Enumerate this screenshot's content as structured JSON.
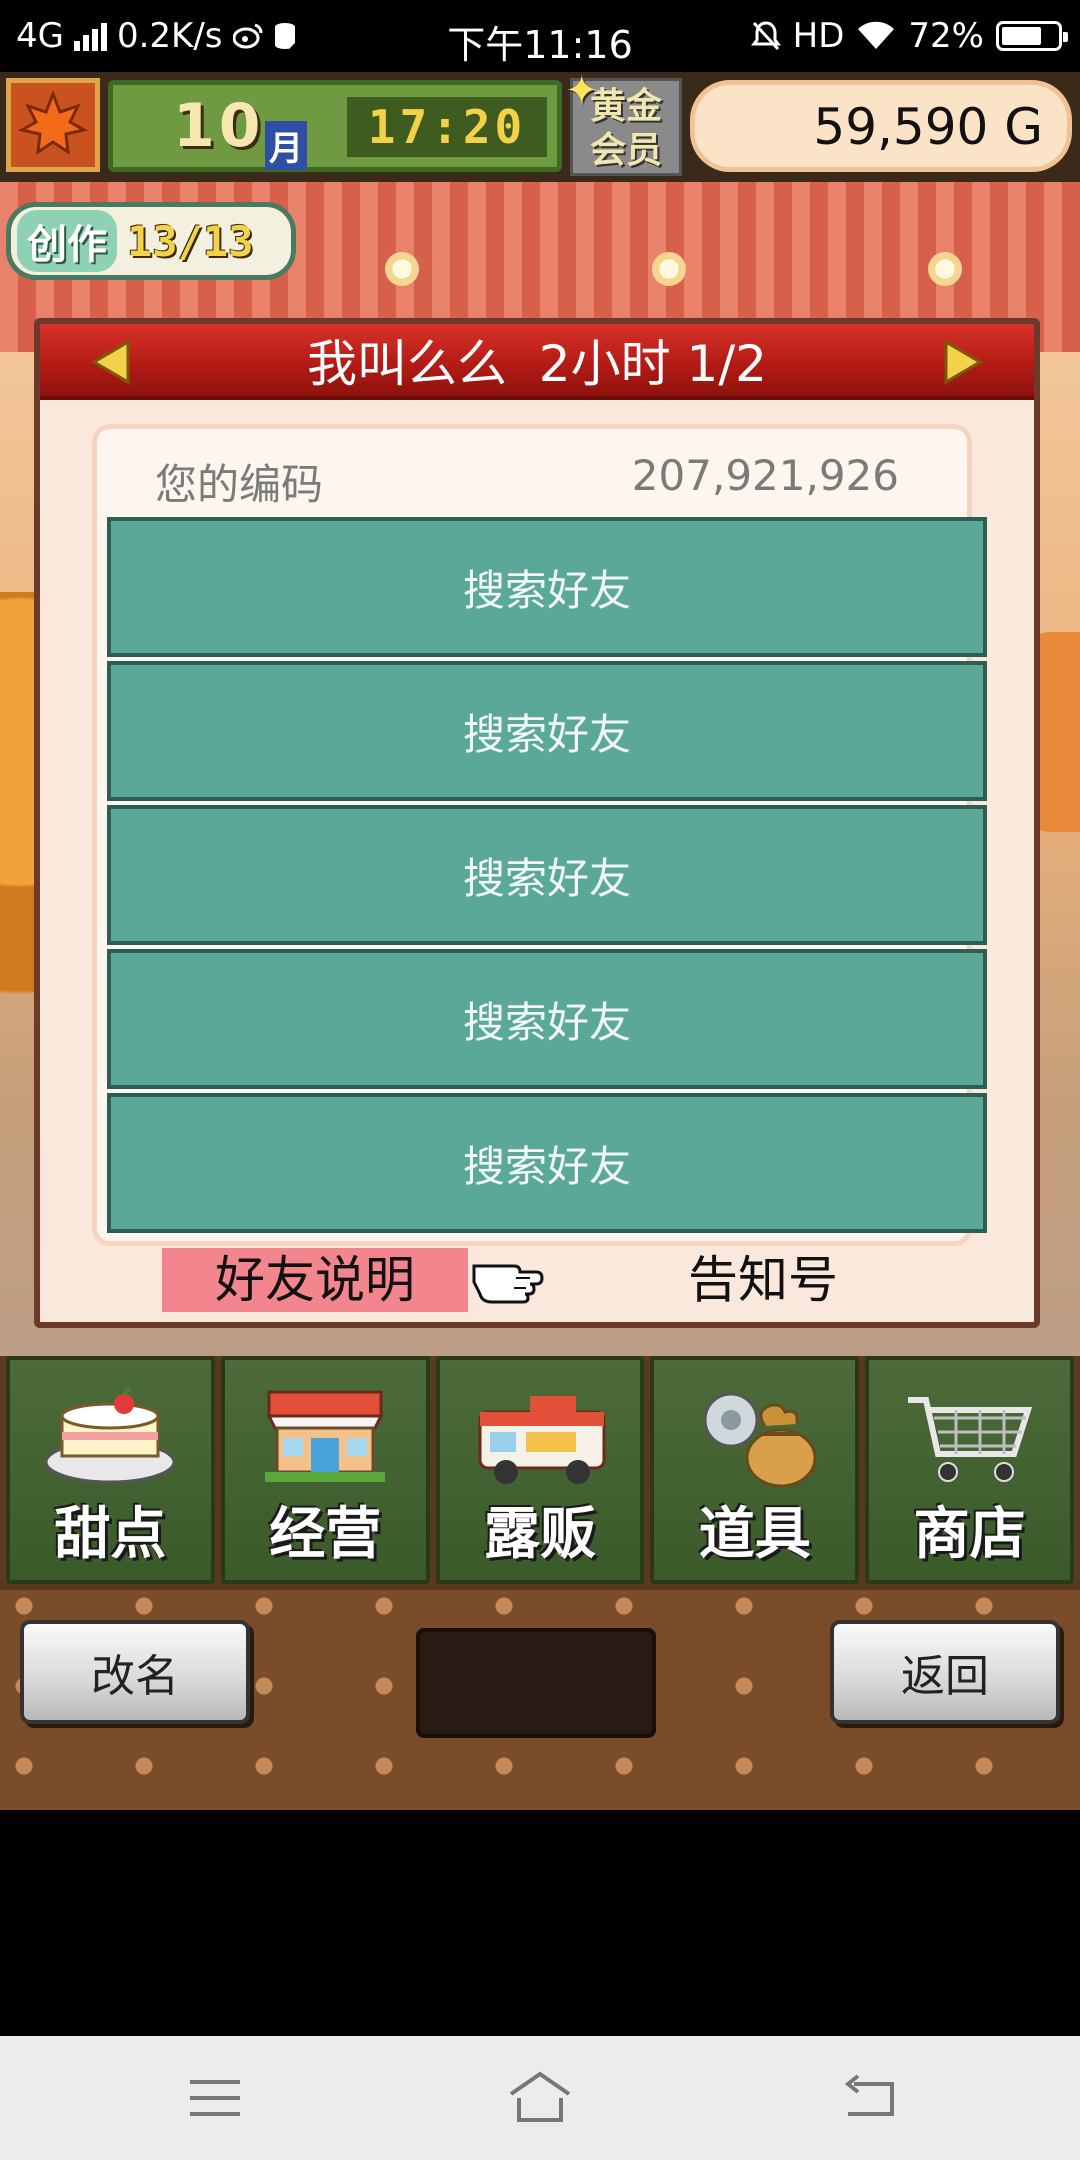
{
  "status_bar": {
    "network": "4G",
    "speed": "0.2K/s",
    "time": "下午11:16",
    "hd": "HD",
    "battery": "72%",
    "battery_level": 0.72
  },
  "hud": {
    "month": "10",
    "month_unit": "月",
    "clock": "17:20",
    "gold_member": "黄金会员",
    "money": "59,590 G"
  },
  "create_badge": {
    "label": "创作",
    "count": "13/13"
  },
  "dialog": {
    "title": "我叫么么  2小时 1/2",
    "code_label": "您的编码",
    "code_value": "207,921,926",
    "friend_slots": [
      "搜索好友",
      "搜索好友",
      "搜索好友",
      "搜索好友",
      "搜索好友"
    ],
    "explain_button": "好友说明",
    "notice_id": "告知号"
  },
  "menu": {
    "items": [
      {
        "label": "甜点",
        "icon": "cake-icon"
      },
      {
        "label": "经营",
        "icon": "shop-icon"
      },
      {
        "label": "露贩",
        "icon": "food-truck-icon"
      },
      {
        "label": "道具",
        "icon": "item-bag-icon"
      },
      {
        "label": "商店",
        "icon": "shopping-cart-icon"
      }
    ]
  },
  "bottom_bar": {
    "rename_label": "改名",
    "back_label": "返回"
  },
  "colors": {
    "friend_slot": "#5ba898",
    "header_red": "#b01a14",
    "explain_pink": "#f2858e"
  }
}
